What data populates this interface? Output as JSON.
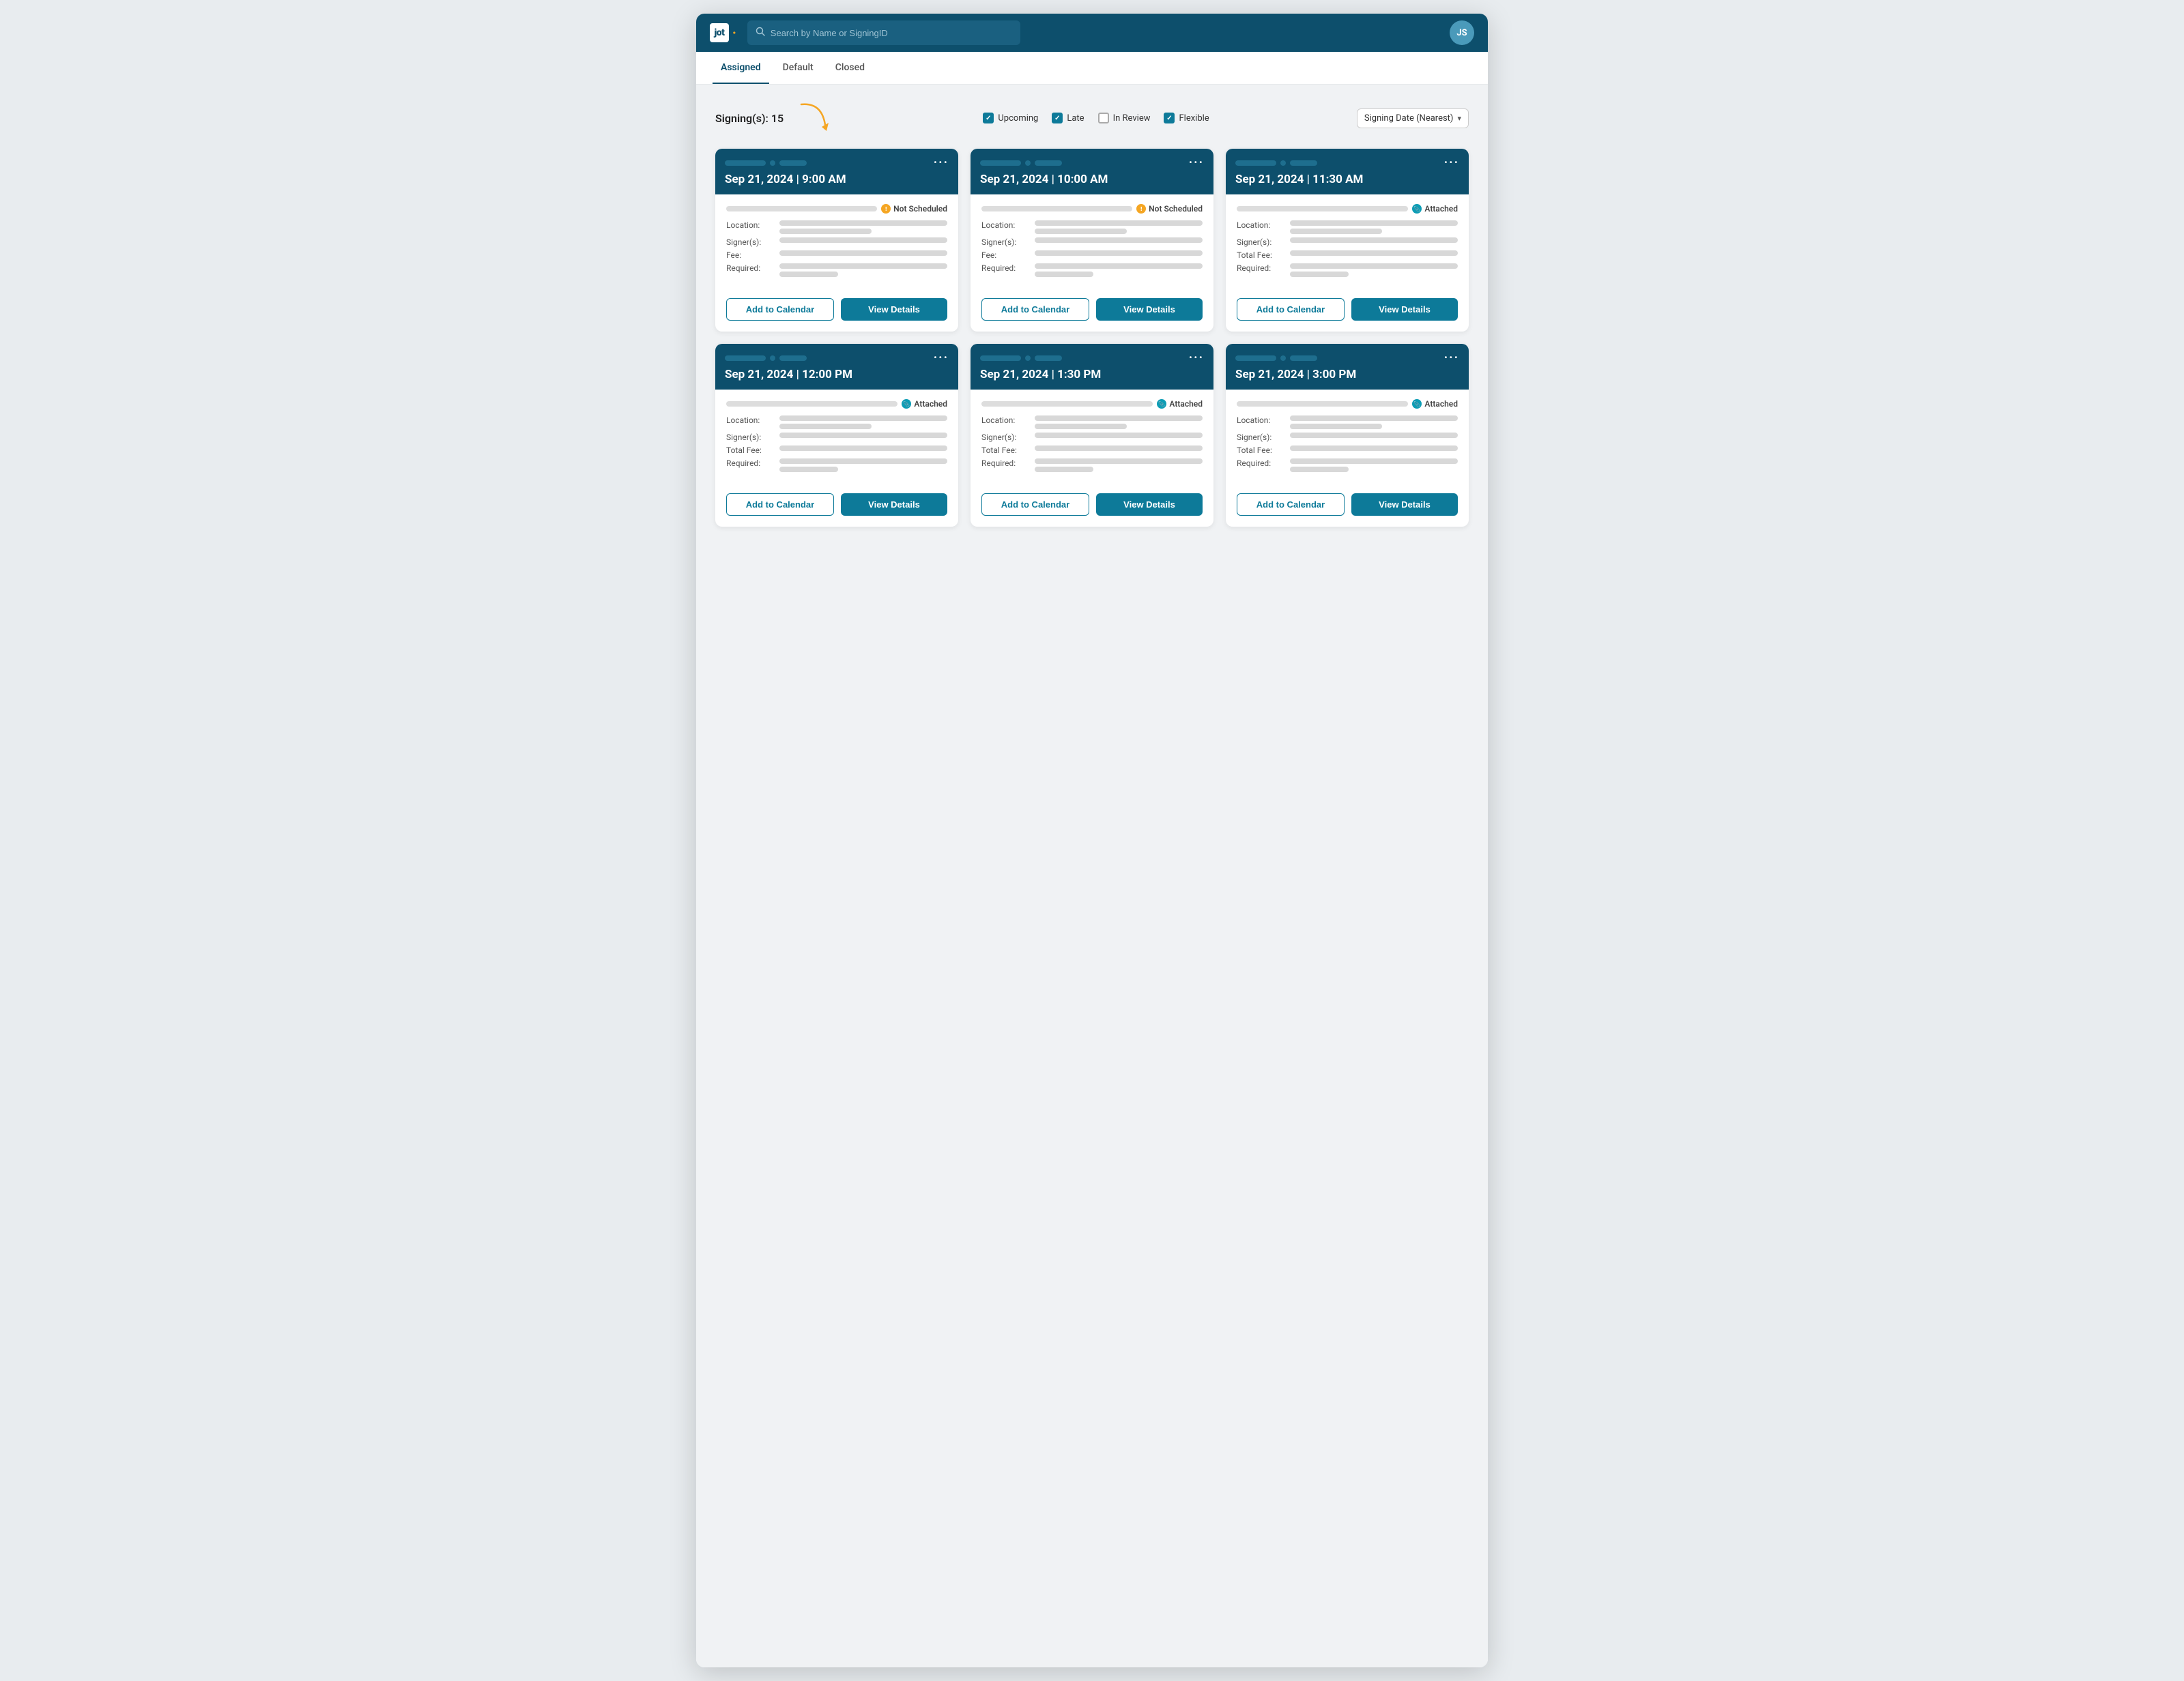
{
  "app": {
    "logo_text": "jot",
    "logo_dot": "·",
    "avatar_initials": "JS"
  },
  "navbar": {
    "search_placeholder": "Search by Name or SigningID"
  },
  "tabs": [
    {
      "id": "assigned",
      "label": "Assigned",
      "active": true
    },
    {
      "id": "default",
      "label": "Default",
      "active": false
    },
    {
      "id": "closed",
      "label": "Closed",
      "active": false
    }
  ],
  "toolbar": {
    "signings_label": "Signing(s): 15",
    "filters": [
      {
        "id": "upcoming",
        "label": "Upcoming",
        "checked": true
      },
      {
        "id": "late",
        "label": "Late",
        "checked": true
      },
      {
        "id": "in_review",
        "label": "In Review",
        "checked": false
      },
      {
        "id": "flexible",
        "label": "Flexible",
        "checked": true
      }
    ],
    "sort_label": "Signing Date (Nearest)"
  },
  "cards": [
    {
      "datetime": "Sep 21, 2024 | 9:00 AM",
      "status_type": "not_scheduled",
      "status_label": "Not Scheduled",
      "fields": [
        {
          "label": "Location:",
          "bars": [
            "full",
            "half"
          ]
        },
        {
          "label": "Signer(s):",
          "bars": [
            "full"
          ]
        },
        {
          "label": "Fee:",
          "bars": [
            "full"
          ]
        },
        {
          "label": "Required:",
          "bars": [
            "full",
            "short"
          ]
        }
      ],
      "btn_calendar": "Add to Calendar",
      "btn_details": "View Details"
    },
    {
      "datetime": "Sep 21, 2024 | 10:00 AM",
      "status_type": "not_scheduled",
      "status_label": "Not Scheduled",
      "fields": [
        {
          "label": "Location:",
          "bars": [
            "full",
            "half"
          ]
        },
        {
          "label": "Signer(s):",
          "bars": [
            "full"
          ]
        },
        {
          "label": "Fee:",
          "bars": [
            "full"
          ]
        },
        {
          "label": "Required:",
          "bars": [
            "full",
            "short"
          ]
        }
      ],
      "btn_calendar": "Add to Calendar",
      "btn_details": "View Details"
    },
    {
      "datetime": "Sep 21, 2024 | 11:30 AM",
      "status_type": "attached",
      "status_label": "Attached",
      "fields": [
        {
          "label": "Location:",
          "bars": [
            "full",
            "half"
          ]
        },
        {
          "label": "Signer(s):",
          "bars": [
            "full"
          ]
        },
        {
          "label": "Total Fee:",
          "bars": [
            "full"
          ]
        },
        {
          "label": "Required:",
          "bars": [
            "full",
            "short"
          ]
        }
      ],
      "btn_calendar": "Add to Calendar",
      "btn_details": "View Details"
    },
    {
      "datetime": "Sep 21, 2024 | 12:00 PM",
      "status_type": "attached",
      "status_label": "Attached",
      "fields": [
        {
          "label": "Location:",
          "bars": [
            "full",
            "half"
          ]
        },
        {
          "label": "Signer(s):",
          "bars": [
            "full"
          ]
        },
        {
          "label": "Total Fee:",
          "bars": [
            "full"
          ]
        },
        {
          "label": "Required:",
          "bars": [
            "full",
            "short"
          ]
        }
      ],
      "btn_calendar": "Add to Calendar",
      "btn_details": "View Details"
    },
    {
      "datetime": "Sep 21, 2024 | 1:30 PM",
      "status_type": "attached",
      "status_label": "Attached",
      "fields": [
        {
          "label": "Location:",
          "bars": [
            "full",
            "half"
          ]
        },
        {
          "label": "Signer(s):",
          "bars": [
            "full"
          ]
        },
        {
          "label": "Total Fee:",
          "bars": [
            "full"
          ]
        },
        {
          "label": "Required:",
          "bars": [
            "full",
            "short"
          ]
        }
      ],
      "btn_calendar": "Add to Calendar",
      "btn_details": "View Details"
    },
    {
      "datetime": "Sep 21, 2024 | 3:00 PM",
      "status_type": "attached",
      "status_label": "Attached",
      "fields": [
        {
          "label": "Location:",
          "bars": [
            "full",
            "half"
          ]
        },
        {
          "label": "Signer(s):",
          "bars": [
            "full"
          ]
        },
        {
          "label": "Total Fee:",
          "bars": [
            "full"
          ]
        },
        {
          "label": "Required:",
          "bars": [
            "full",
            "short"
          ]
        }
      ],
      "btn_calendar": "Add to Calendar",
      "btn_details": "View Details"
    }
  ]
}
